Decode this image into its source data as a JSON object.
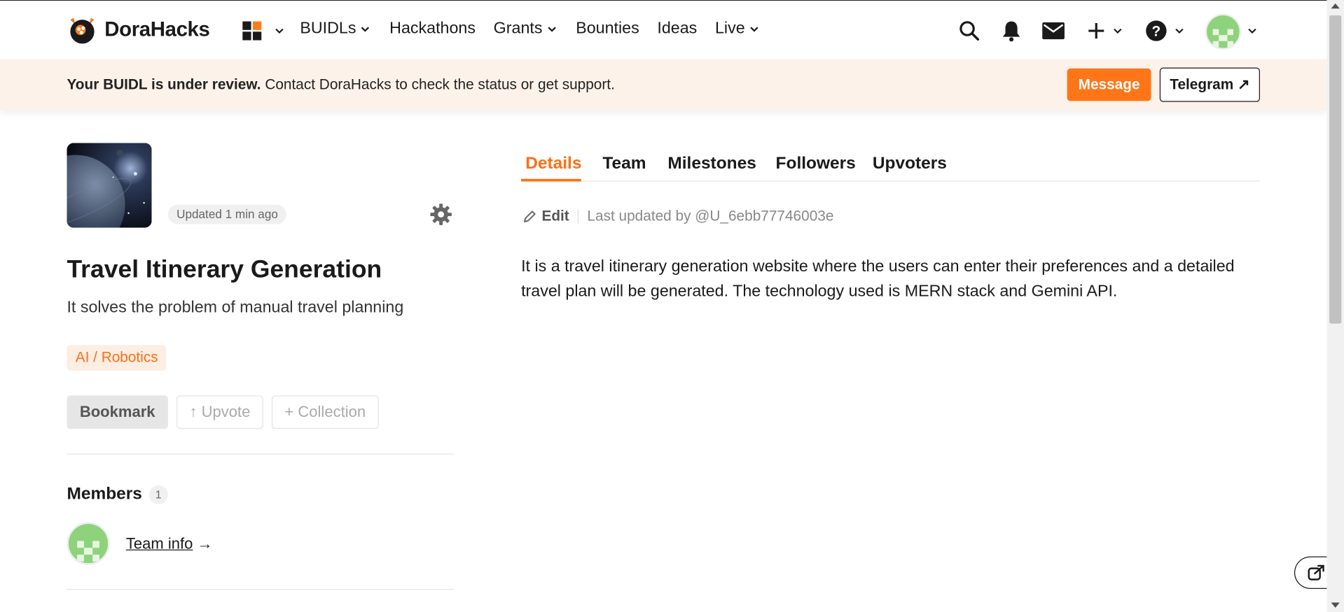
{
  "header": {
    "logo_text": "DoraHacks",
    "nav": [
      {
        "label": "BUIDLs",
        "has_dropdown": true
      },
      {
        "label": "Hackathons",
        "has_dropdown": false
      },
      {
        "label": "Grants",
        "has_dropdown": true
      },
      {
        "label": "Bounties",
        "has_dropdown": false
      },
      {
        "label": "Ideas",
        "has_dropdown": false
      },
      {
        "label": "Live",
        "has_dropdown": true
      }
    ],
    "icons": [
      "apps-grid-icon",
      "search-icon",
      "bell-icon",
      "mail-icon",
      "plus-icon",
      "help-icon",
      "avatar"
    ]
  },
  "banner": {
    "bold_text": "Your BUIDL is under review.",
    "text": " Contact DoraHacks to check the status or get support.",
    "message_button": "Message",
    "telegram_button": "Telegram ↗"
  },
  "buidl": {
    "updated_badge": "Updated 1 min ago",
    "title": "Travel Itinerary Generation",
    "subtitle": "It solves the problem of manual travel planning",
    "tag": "AI / Robotics",
    "actions": {
      "bookmark": "Bookmark",
      "upvote": "↑ Upvote",
      "collection": "+ Collection"
    },
    "members": {
      "title": "Members",
      "count": "1",
      "team_link": "Team info",
      "arrow": " →"
    }
  },
  "tabs": {
    "items": [
      "Details",
      "Team",
      "Milestones",
      "Followers",
      "Upvoters"
    ],
    "active": "Details"
  },
  "details": {
    "edit_label": "Edit",
    "last_updated": "Last updated by @U_6ebb77746003e",
    "description": "It is a travel itinerary generation website where the users can enter their preferences and a detailed travel plan will be generated. The technology used is MERN stack and Gemini API."
  },
  "colors": {
    "accent": "#ff6f12",
    "banner_bg": "#fdf2ea",
    "avatar_green": "#8fd27c"
  }
}
